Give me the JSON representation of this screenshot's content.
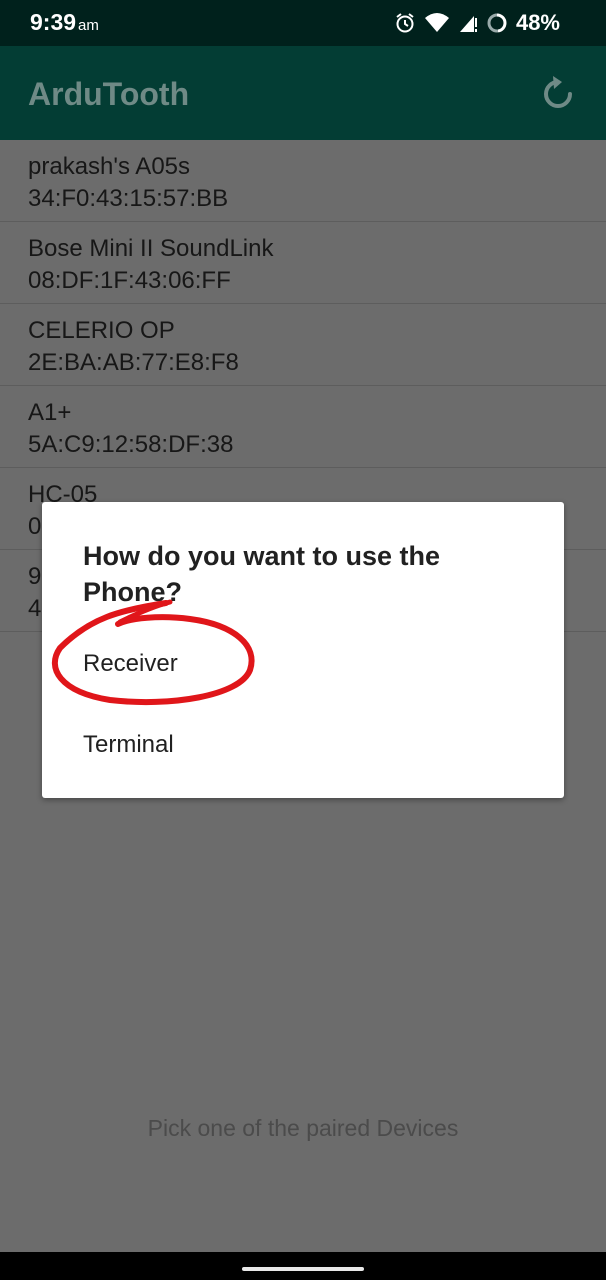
{
  "status_bar": {
    "time": "9:39",
    "ampm": "am",
    "battery": "48%"
  },
  "app_bar": {
    "title": "ArduTooth"
  },
  "devices": [
    {
      "name": "prakash's A05s",
      "address": "34:F0:43:15:57:BB"
    },
    {
      "name": "Bose Mini II SoundLink",
      "address": "08:DF:1F:43:06:FF"
    },
    {
      "name": "CELERIO OP",
      "address": "2E:BA:AB:77:E8:F8"
    },
    {
      "name": "A1+",
      "address": "5A:C9:12:58:DF:38"
    },
    {
      "name": "HC-05",
      "address": "0"
    },
    {
      "name": "9",
      "address": "4"
    }
  ],
  "hint": "Pick one of the paired Devices",
  "dialog": {
    "title": "How do you want to use the Phone?",
    "options": [
      "Receiver",
      "Terminal"
    ]
  },
  "colors": {
    "appbar": "#033d34",
    "statusbar": "#00211c",
    "annotation": "#e0161a"
  }
}
